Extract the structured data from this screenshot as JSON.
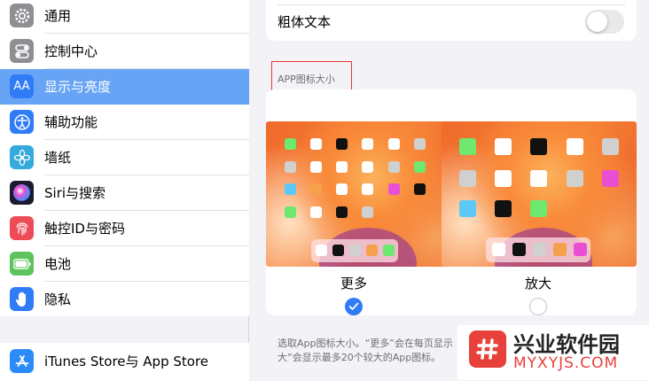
{
  "sidebar": {
    "items": [
      {
        "label": "通用",
        "icon": "gear-icon",
        "color": "#8e8e93"
      },
      {
        "label": "控制中心",
        "icon": "toggles-icon",
        "color": "#8e8e93"
      },
      {
        "label": "显示与亮度",
        "icon": "text-size-icon",
        "color": "#2f7cf6",
        "icon_text": "AA"
      },
      {
        "label": "辅助功能",
        "icon": "accessibility-icon",
        "color": "#2f7cf6"
      },
      {
        "label": "墙纸",
        "icon": "flower-icon",
        "color": "#35aadc"
      },
      {
        "label": "Siri与搜索",
        "icon": "siri-icon",
        "color": "#1b1b2f"
      },
      {
        "label": "触控ID与密码",
        "icon": "fingerprint-icon",
        "color": "#ee4b58"
      },
      {
        "label": "电池",
        "icon": "battery-icon",
        "color": "#5dc45d"
      },
      {
        "label": "隐私",
        "icon": "hand-icon",
        "color": "#2f7cf6"
      }
    ],
    "store_item": {
      "label": "iTunes Store与 App Store",
      "icon": "app-store-icon",
      "color": "#2b8cf7"
    }
  },
  "main": {
    "bold_text_label": "粗体文本",
    "bold_text_on": false,
    "section_header": "APP图标大小",
    "options": [
      {
        "label": "更多",
        "selected": true
      },
      {
        "label": "放大",
        "selected": false
      }
    ],
    "footer": "选取App图标大小。“更多”会在每页显示",
    "footer_line2": "大”会显示最多20个较大的App图标。"
  },
  "watermark": {
    "title": "兴业软件园",
    "url": "MYXYJS.COM",
    "color": "#e8403a"
  },
  "accent": "#2f7cf6"
}
